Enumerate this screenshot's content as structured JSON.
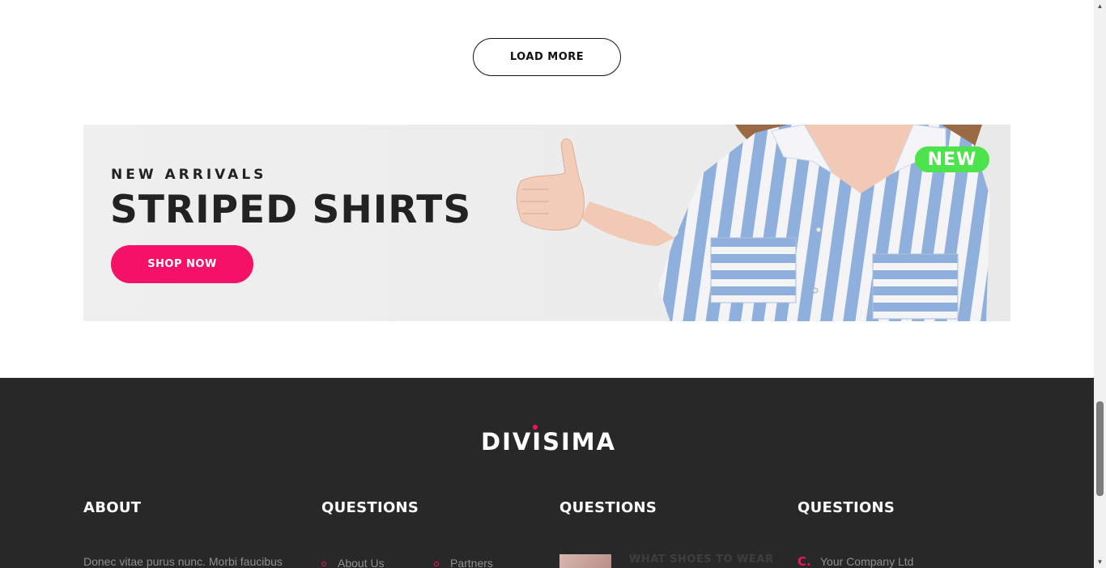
{
  "load_more": {
    "label": "LOAD MORE"
  },
  "banner": {
    "subtitle": "NEW ARRIVALS",
    "title": "STRIPED SHIRTS",
    "cta": "SHOP NOW",
    "badge": "NEW",
    "accent_color": "#f51167",
    "badge_color": "#4ce34c"
  },
  "footer": {
    "logo": "DIVISIMA",
    "columns": [
      {
        "title": "ABOUT"
      },
      {
        "title": "QUESTIONS"
      },
      {
        "title": "QUESTIONS"
      },
      {
        "title": "QUESTIONS"
      }
    ],
    "about_text": "Donec vitae purus nunc. Morbi faucibus",
    "links": [
      "About Us",
      "Partners"
    ],
    "blog_title": "WHAT SHOES TO WEAR",
    "contact_icon": "C.",
    "contact_text": "Your Company Ltd",
    "background_color": "#282828"
  },
  "scrollbar": {
    "up_icon": "scroll-up-icon",
    "down_icon": "scroll-down-icon"
  }
}
